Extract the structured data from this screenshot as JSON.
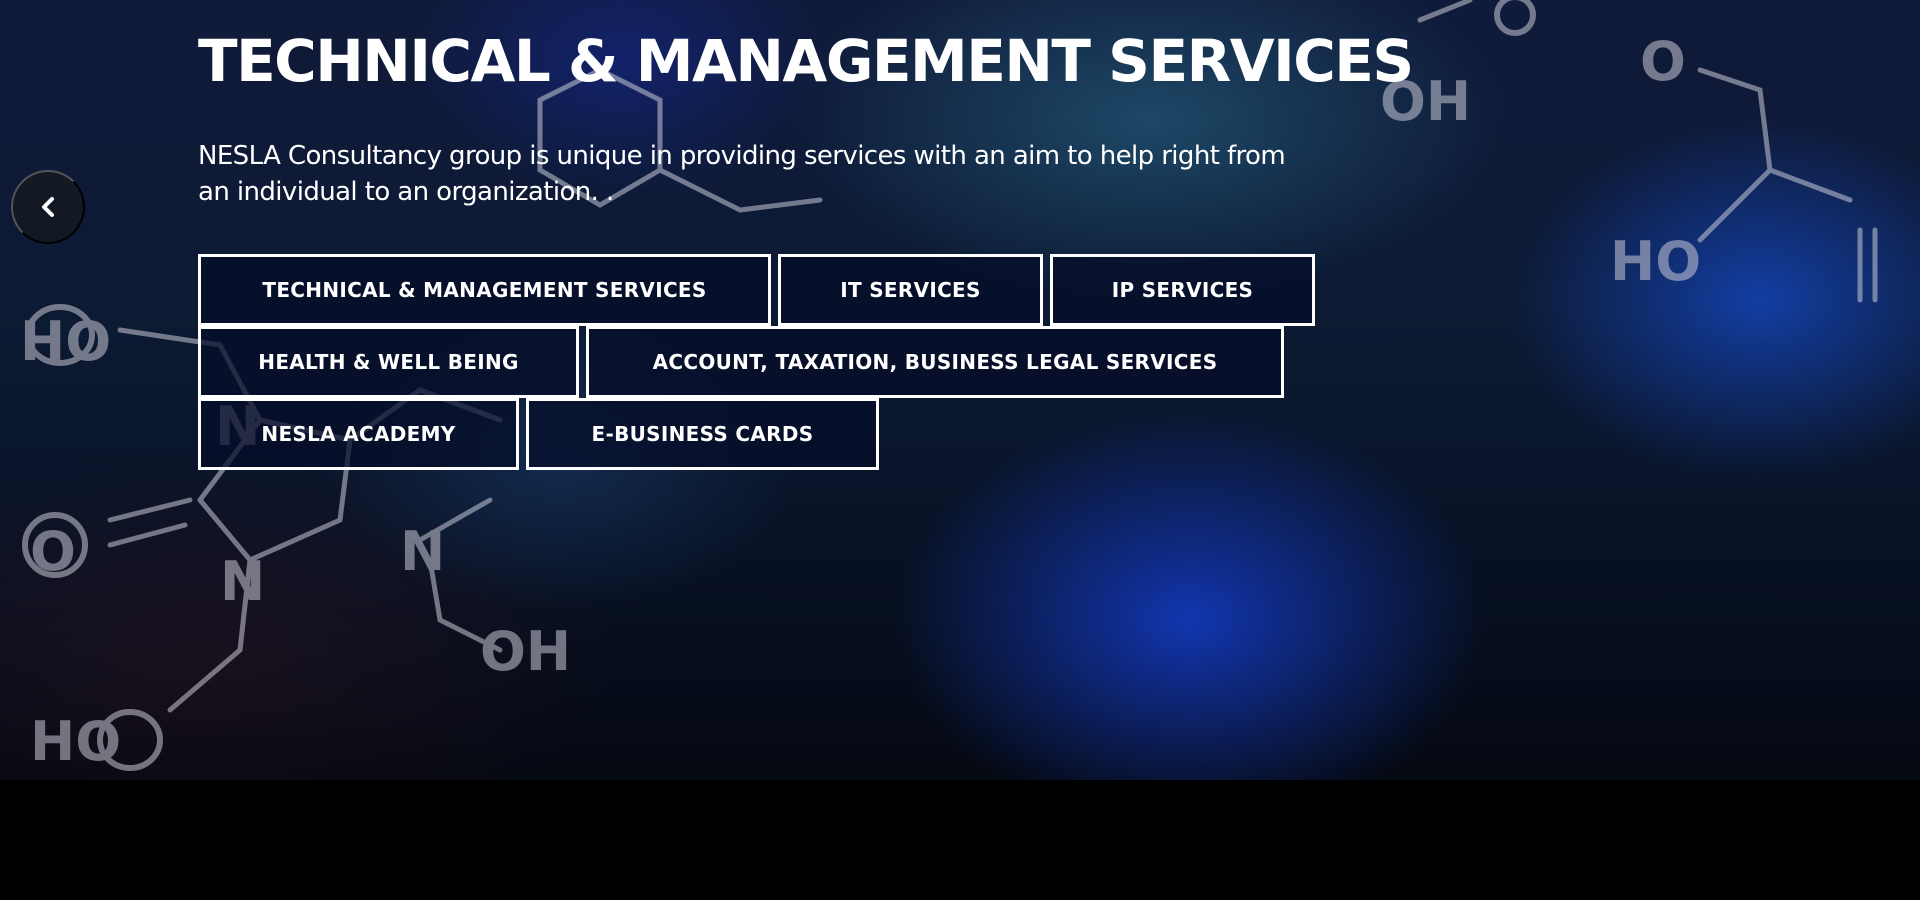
{
  "hero": {
    "title": "TECHNICAL & MANAGEMENT SERVICES",
    "description": "NESLA Consultancy group is unique in providing services with an aim to help right from an individual to an organization. .",
    "service_buttons": [
      {
        "label": "TECHNICAL & MANAGEMENT SERVICES"
      },
      {
        "label": "IT SERVICES"
      },
      {
        "label": "IP SERVICES"
      },
      {
        "label": "HEALTH & WELL BEING"
      },
      {
        "label": "ACCOUNT, TAXATION, BUSINESS LEGAL SERVICES"
      },
      {
        "label": "NESLA ACADEMY"
      },
      {
        "label": "E-BUSINESS CARDS"
      }
    ]
  },
  "slider": {
    "prev_icon": "chevron-left-icon"
  },
  "colors": {
    "text": "#ffffff",
    "button_border": "#ffffff",
    "button_fill": "#050c28",
    "page_background": "#000000"
  }
}
